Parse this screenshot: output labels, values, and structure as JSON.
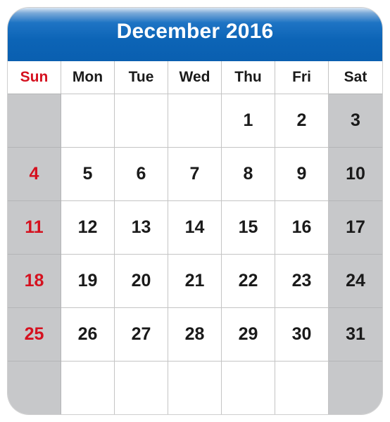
{
  "title": "December 2016",
  "colors": {
    "header_blue": "#0c64b6",
    "sunday_red": "#d5111f",
    "weekend_gray": "#c7c8ca",
    "text": "#1a1a1a"
  },
  "day_names": [
    "Sun",
    "Mon",
    "Tue",
    "Wed",
    "Thu",
    "Fri",
    "Sat"
  ],
  "weeks": [
    [
      "",
      "",
      "",
      "",
      "1",
      "2",
      "3"
    ],
    [
      "4",
      "5",
      "6",
      "7",
      "8",
      "9",
      "10"
    ],
    [
      "11",
      "12",
      "13",
      "14",
      "15",
      "16",
      "17"
    ],
    [
      "18",
      "19",
      "20",
      "21",
      "22",
      "23",
      "24"
    ],
    [
      "25",
      "26",
      "27",
      "28",
      "29",
      "30",
      "31"
    ],
    [
      "",
      "",
      "",
      "",
      "",
      "",
      ""
    ]
  ]
}
